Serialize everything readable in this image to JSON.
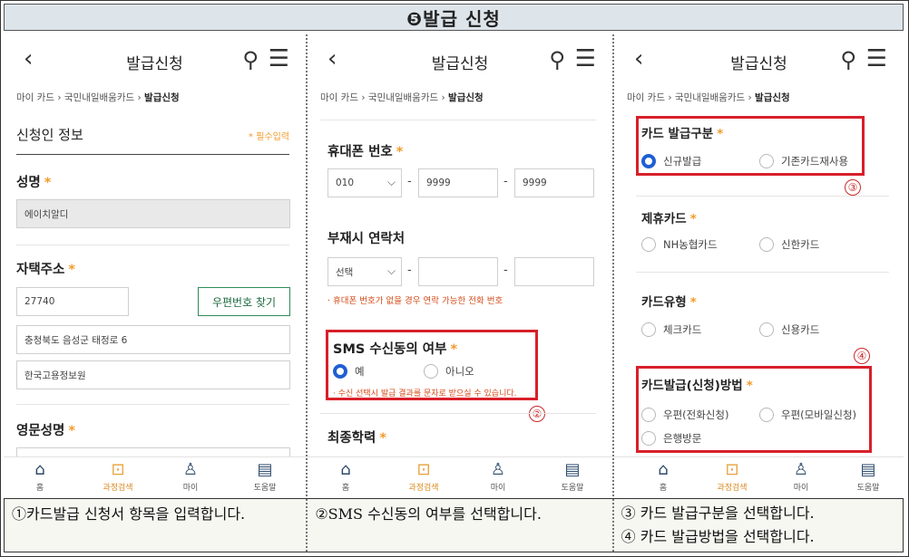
{
  "title": "❺발급 신청",
  "panel1": {
    "header_title": "발급신청",
    "breadcrumb": [
      "마이 카드",
      "국민내일배움카드",
      "발급신청"
    ],
    "section_title": "신청인 정보",
    "required_hint": "* 필수입력",
    "name_label": "성명",
    "name_value": "에이치알디",
    "address_label": "자택주소",
    "zip_value": "27740",
    "zip_button": "우편번호 찾기",
    "address1": "충청북도 음성군 태정로 6",
    "address2": "한국고용정보원",
    "eng_name_label": "영문성명"
  },
  "panel2": {
    "header_title": "발급신청",
    "breadcrumb": [
      "마이 카드",
      "국민내일배움카드",
      "발급신청"
    ],
    "phone_label": "휴대폰 번호",
    "phone_prefix": "010",
    "phone_mid": "9999",
    "phone_last": "9999",
    "alt_contact_label": "부재시 연락처",
    "alt_select": "선택",
    "alt_note": "· 휴대폰 번호가 없을 경우 연락 가능한 전화 번호",
    "sms_label": "SMS 수신동의 여부",
    "sms_yes": "예",
    "sms_no": "아니오",
    "sms_note": "· 수신 선택시 발급 결과를 문자로 받으실 수 있습니다.",
    "education_label": "최종학력",
    "marker": "②"
  },
  "panel3": {
    "header_title": "발급신청",
    "breadcrumb": [
      "마이 카드",
      "국민내일배움카드",
      "발급신청"
    ],
    "issue_type_label": "카드 발급구분",
    "issue_new": "신규발급",
    "issue_reuse": "기존카드재사용",
    "marker3": "③",
    "partner_label": "제휴카드",
    "partner_nh": "NH농협카드",
    "partner_shinhan": "신한카드",
    "card_type_label": "카드유형",
    "type_check": "체크카드",
    "type_credit": "신용카드",
    "marker4": "④",
    "method_label": "카드발급(신청)방법",
    "method_phone": "우편(전화신청)",
    "method_mobile": "우편(모바일신청)",
    "method_bank": "은행방문"
  },
  "nav": {
    "home": "홈",
    "search": "과정검색",
    "my": "마이",
    "help": "도움말"
  },
  "captions": {
    "cap1": "①카드발급 신청서 항목을 입력합니다.",
    "cap2": "②SMS 수신동의 여부를 선택합니다.",
    "cap3_a": "③ 카드 발급구분을 선택합니다.",
    "cap3_b": "④ 카드 발급방법을 선택합니다."
  },
  "colors": {
    "required": "#f39a2a",
    "highlight": "#d8202a",
    "radio_selected": "#1f5fd4",
    "zip_button": "#2e8b57"
  }
}
